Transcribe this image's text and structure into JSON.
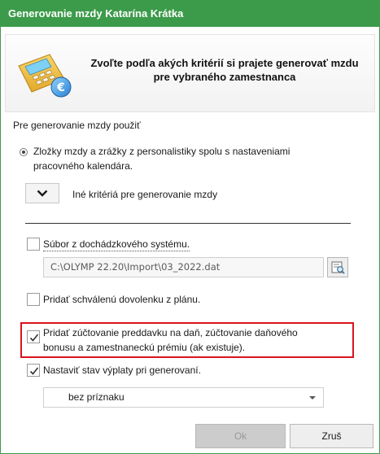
{
  "window": {
    "title": "Generovanie mzdy Katarína Krátka"
  },
  "header": {
    "title": "Zvoľte podľa akých kritérií si prajete generovať mzdu pre vybraného zamestnanca",
    "icon": "calculator-euro-icon"
  },
  "section": {
    "label": "Pre generovanie mzdy použiť"
  },
  "radio_option": {
    "label": "Zložky mzdy a zrážky z personalistiky spolu s nastaveniami pracovného kalendára.",
    "selected": true
  },
  "other_criteria": {
    "label": "Iné kritériá pre generovanie mzdy",
    "icon": "chevron-down-icon"
  },
  "attendance": {
    "label": "Súbor z dochádzkového systému.",
    "checked": false,
    "path": "C:\\OLYMP 22.20\\Import\\03_2022.dat"
  },
  "vacation": {
    "label": "Pridať schválenú dovolenku z plánu.",
    "checked": false
  },
  "advance_tax": {
    "label": "Pridať zúčtovanie preddavku na daň, zúčtovanie daňového bonusu a zamestnaneckú prémiu (ak existuje).",
    "checked": true
  },
  "payout_state": {
    "label": "Nastaviť stav výplaty pri generovaní.",
    "checked": true,
    "value": "bez príznaku"
  },
  "buttons": {
    "ok": "Ok",
    "cancel": "Zruš"
  },
  "colors": {
    "titlebar": "#3c9b4a",
    "highlight": "#d9141d"
  }
}
